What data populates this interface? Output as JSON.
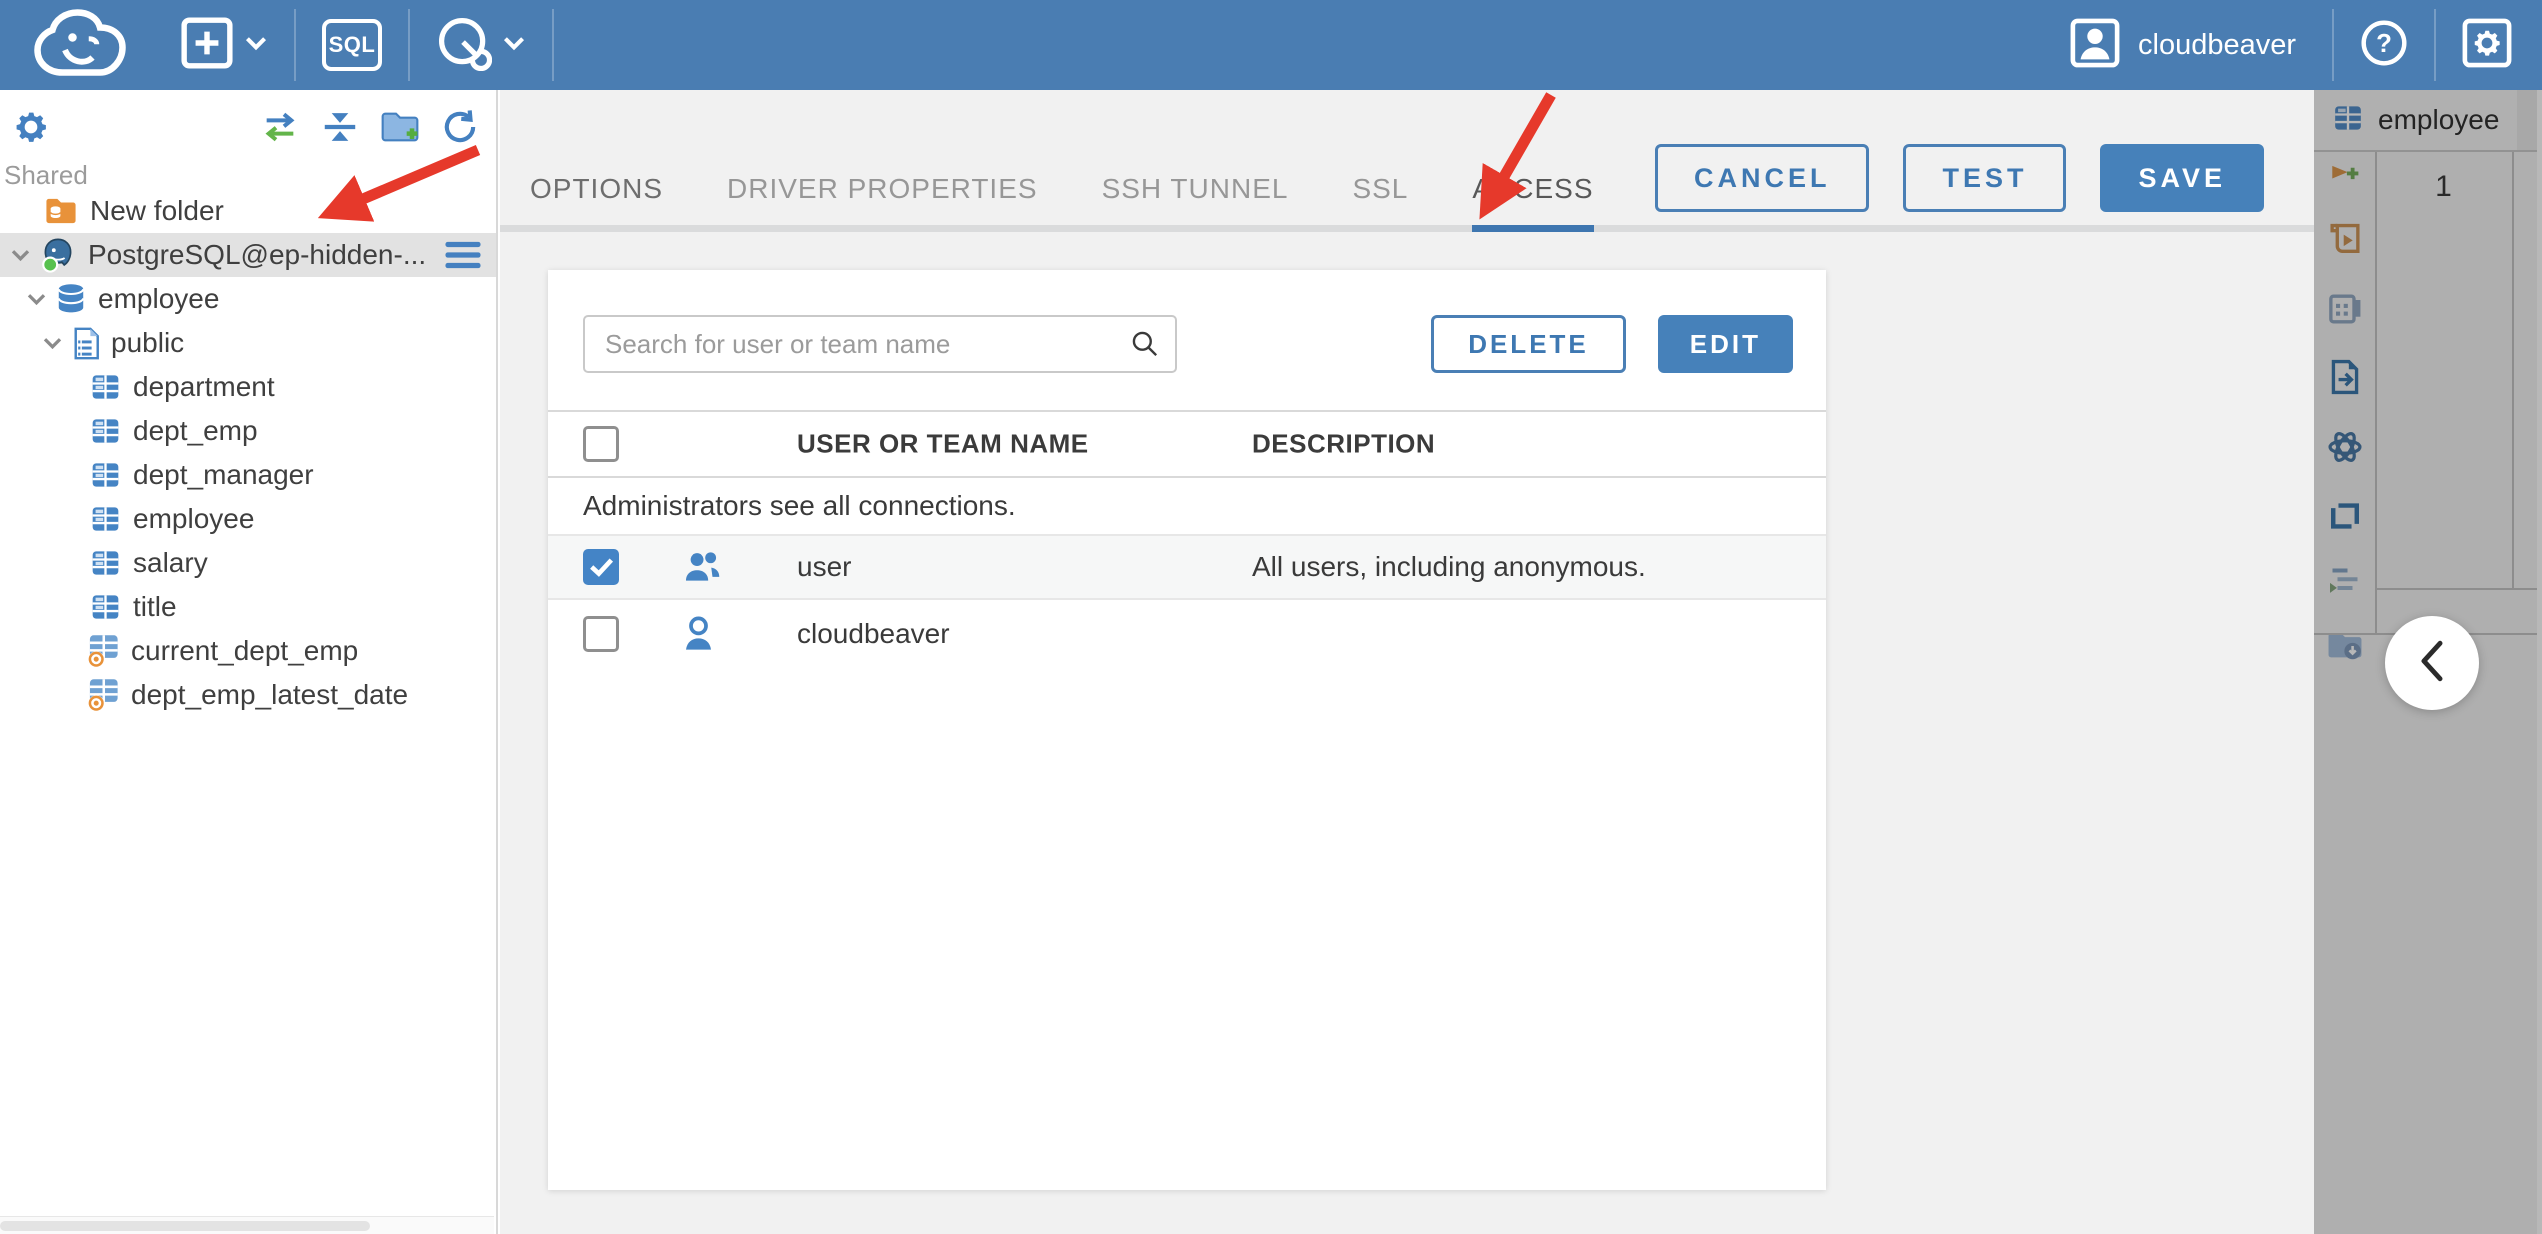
{
  "topbar": {
    "logo_icon": "cloudbeaver-logo",
    "new_item_icon": "plus-square-icon",
    "sql_editor_label": "SQL",
    "connection_icon": "wrench-circle-icon",
    "user_name": "cloudbeaver",
    "avatar_icon": "user-avatar-icon",
    "help_icon": "help-circle-icon",
    "settings_icon": "settings-square-icon"
  },
  "sidebar": {
    "toolbar_icons": [
      "settings-gear-icon",
      "sync-connections-icon",
      "collapse-all-icon",
      "new-folder-icon",
      "refresh-icon"
    ],
    "section_label": "Shared",
    "tree": [
      {
        "label": "New folder",
        "type": "folder",
        "indent": 44,
        "chevron": false
      },
      {
        "label": "PostgreSQL@ep-hidden-...",
        "type": "postgres-connection",
        "indent": 10,
        "chevron": true,
        "selected": true,
        "menu": true,
        "status": "connected"
      },
      {
        "label": "employee",
        "type": "database",
        "indent": 26,
        "chevron": true
      },
      {
        "label": "public",
        "type": "schema",
        "indent": 42,
        "chevron": true
      },
      {
        "label": "department",
        "type": "table",
        "indent": 90
      },
      {
        "label": "dept_emp",
        "type": "table",
        "indent": 90
      },
      {
        "label": "dept_manager",
        "type": "table",
        "indent": 90
      },
      {
        "label": "employee",
        "type": "table",
        "indent": 90
      },
      {
        "label": "salary",
        "type": "table",
        "indent": 90
      },
      {
        "label": "title",
        "type": "table",
        "indent": 90
      },
      {
        "label": "current_dept_emp",
        "type": "view",
        "indent": 86
      },
      {
        "label": "dept_emp_latest_date",
        "type": "view",
        "indent": 86
      }
    ]
  },
  "dialog": {
    "tabs": [
      {
        "label": "OPTIONS",
        "active": false,
        "enabled": true
      },
      {
        "label": "DRIVER PROPERTIES",
        "active": false,
        "enabled": false
      },
      {
        "label": "SSH TUNNEL",
        "active": false,
        "enabled": false
      },
      {
        "label": "SSL",
        "active": false,
        "enabled": false
      },
      {
        "label": "ACCESS",
        "active": true,
        "enabled": true
      }
    ],
    "actions": {
      "cancel": "CANCEL",
      "test": "TEST",
      "save": "SAVE"
    },
    "access": {
      "search_placeholder": "Search for user or team name",
      "search_value": "",
      "search_icon": "search-icon",
      "delete_label": "DELETE",
      "edit_label": "EDIT",
      "columns": [
        "USER OR TEAM NAME",
        "DESCRIPTION"
      ],
      "info_row": "Administrators see all connections.",
      "rows": [
        {
          "name": "user",
          "description": "All users, including anonymous.",
          "checked": true,
          "icon": "team-icon"
        },
        {
          "name": "cloudbeaver",
          "description": "",
          "checked": false,
          "icon": "user-icon"
        }
      ]
    }
  },
  "right_panel": {
    "tab_label": "employee",
    "tab_icon": "table-icon",
    "row_number": "1",
    "toolbar_icons": [
      "bookmark-add-icon",
      "script-execute-icon",
      "record-form-icon",
      "export-document-icon",
      "knot-icon",
      "copy-frame-icon",
      "format-list-icon",
      "import-folder-icon"
    ],
    "collapse_icon": "chevron-left-icon"
  },
  "colors": {
    "topbar": "#4a7db2",
    "accent": "#4681ba",
    "accent_border": "#4a7fb5",
    "tab_underline": "#3e76b0",
    "checkbox_checked": "#4484c6",
    "selected_row": "#e2e2e2",
    "dialog_bg": "#f1f1f1",
    "arrow": "#e6392b"
  }
}
